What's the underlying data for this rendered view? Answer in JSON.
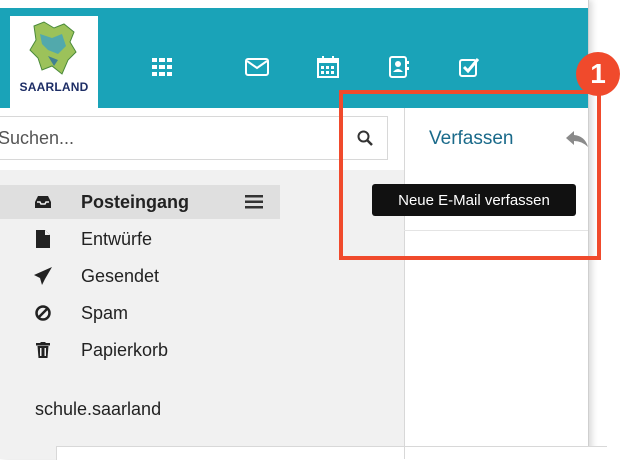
{
  "header": {
    "logo_text": "SAARLAND",
    "nav_icons": [
      "apps-grid-icon",
      "mail-icon",
      "calendar-icon",
      "contacts-icon",
      "tasks-icon"
    ]
  },
  "search": {
    "placeholder": "Suchen..."
  },
  "sidebar": {
    "folders": [
      {
        "label": "Posteingang",
        "icon": "inbox-icon",
        "active": true
      },
      {
        "label": "Entwürfe",
        "icon": "draft-document-icon"
      },
      {
        "label": "Gesendet",
        "icon": "sent-paper-plane-icon"
      },
      {
        "label": "Spam",
        "icon": "spam-block-icon"
      },
      {
        "label": "Papierkorb",
        "icon": "trash-icon"
      }
    ],
    "menu_icon": "hamburger-menu-icon",
    "account": "schule.saarland"
  },
  "toolbar": {
    "compose_label": "Verfassen",
    "reply_icon": "reply-arrow-icon"
  },
  "tooltip": {
    "text": "Neue E-Mail verfassen"
  },
  "annotation": {
    "step_number": "1",
    "color": "#f04a2c"
  },
  "colors": {
    "header_bg": "#1aa3b8",
    "link": "#1a6a8a",
    "sidebar_bg": "#f1f1f1"
  }
}
